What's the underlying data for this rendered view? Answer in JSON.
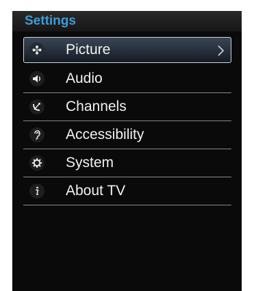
{
  "header": {
    "title": "Settings"
  },
  "menu": {
    "items": [
      {
        "label": "Picture",
        "icon": "picture-icon",
        "selected": true
      },
      {
        "label": "Audio",
        "icon": "speaker-icon",
        "selected": false
      },
      {
        "label": "Channels",
        "icon": "satellite-dish-icon",
        "selected": false
      },
      {
        "label": "Accessibility",
        "icon": "ear-icon",
        "selected": false
      },
      {
        "label": "System",
        "icon": "gear-icon",
        "selected": false
      },
      {
        "label": "About TV",
        "icon": "info-icon",
        "selected": false
      }
    ]
  },
  "colors": {
    "title": "#3e9bd8",
    "background": "#0a0a0a",
    "text": "#f2f2f2"
  }
}
